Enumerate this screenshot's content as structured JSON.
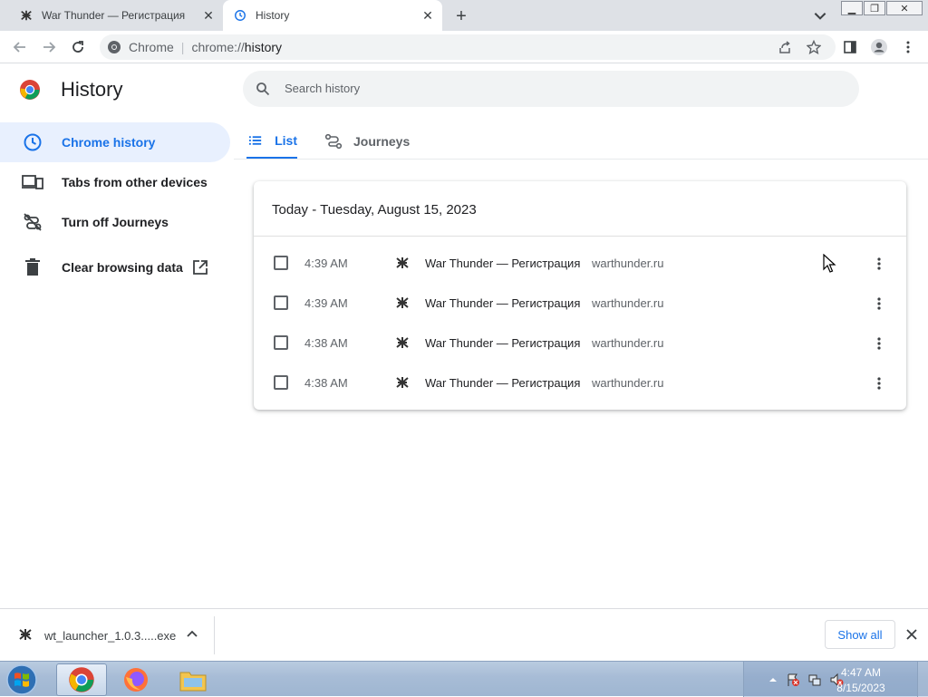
{
  "browser": {
    "tabs": [
      {
        "title": "War Thunder — Регистрация",
        "active": false
      },
      {
        "title": "History",
        "active": true
      }
    ],
    "omnibox": {
      "site_label": "Chrome",
      "url_scheme": "chrome://",
      "url_host": "history"
    }
  },
  "sidebar": {
    "title": "History",
    "items": [
      {
        "label": "Chrome history",
        "icon": "clock-icon",
        "selected": true
      },
      {
        "label": "Tabs from other devices",
        "icon": "devices-icon"
      },
      {
        "label": "Turn off Journeys",
        "icon": "journeys-off-icon"
      },
      {
        "label": "Clear browsing data",
        "icon": "trash-icon",
        "external": true
      }
    ]
  },
  "search": {
    "placeholder": "Search history"
  },
  "view_tabs": {
    "list_label": "List",
    "journeys_label": "Journeys"
  },
  "history": {
    "date_heading": "Today - Tuesday, August 15, 2023",
    "entries": [
      {
        "time": "4:39 AM",
        "title": "War Thunder — Регистрация",
        "domain": "warthunder.ru"
      },
      {
        "time": "4:39 AM",
        "title": "War Thunder — Регистрация",
        "domain": "warthunder.ru"
      },
      {
        "time": "4:38 AM",
        "title": "War Thunder — Регистрация",
        "domain": "warthunder.ru"
      },
      {
        "time": "4:38 AM",
        "title": "War Thunder — Регистрация",
        "domain": "warthunder.ru"
      }
    ]
  },
  "downloads": {
    "file_name": "wt_launcher_1.0.3.....exe",
    "show_all_label": "Show all"
  },
  "taskbar": {
    "clock_time": "4:47 AM",
    "clock_date": "8/15/2023"
  },
  "colors": {
    "accent": "#1a73e8",
    "selected_bg": "#e8f0fe"
  }
}
